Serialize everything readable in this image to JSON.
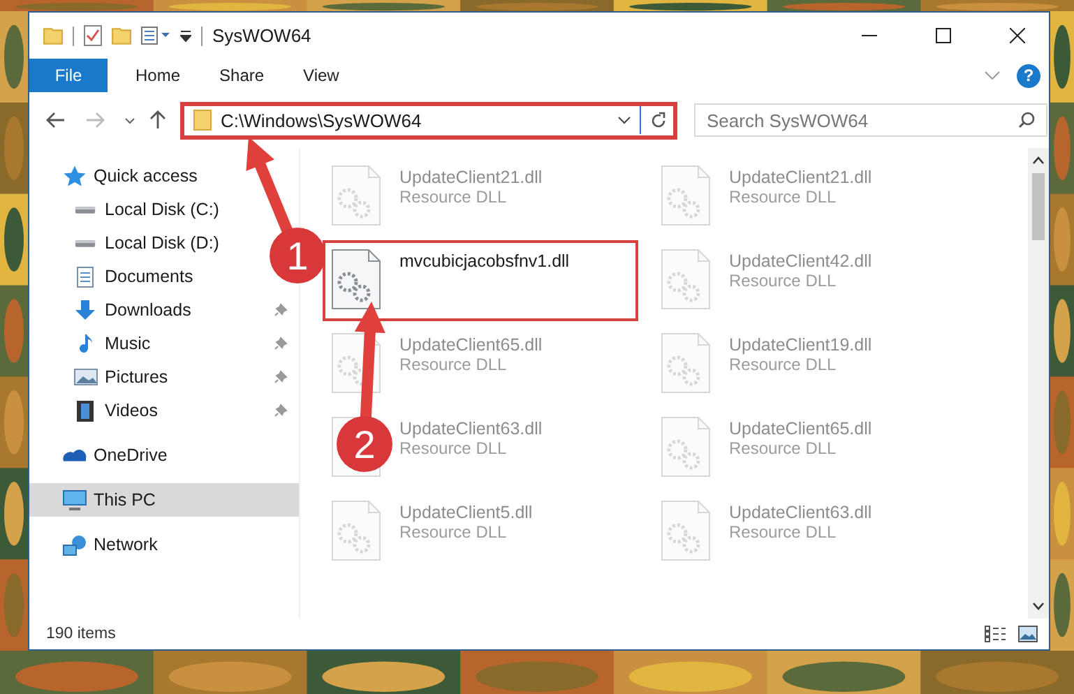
{
  "window": {
    "title": "SysWOW64"
  },
  "ribbon_tabs": [
    {
      "label": "File",
      "selected": true
    },
    {
      "label": "Home",
      "selected": false
    },
    {
      "label": "Share",
      "selected": false
    },
    {
      "label": "View",
      "selected": false
    }
  ],
  "help_button": {
    "label": "?"
  },
  "address_bar": {
    "path": "C:\\Windows\\SysWOW64",
    "highlighted": true
  },
  "search": {
    "placeholder": "Search SysWOW64"
  },
  "sidebar": {
    "items": [
      {
        "label": "Quick access",
        "kind": "star",
        "selected": false,
        "children": [
          {
            "label": "Local Disk (C:)",
            "kind": "drive",
            "pinned": false,
            "selected": false
          },
          {
            "label": "Local Disk (D:)",
            "kind": "drive",
            "pinned": false,
            "selected": false
          },
          {
            "label": "Documents",
            "kind": "document",
            "pinned": false,
            "selected": false
          },
          {
            "label": "Downloads",
            "kind": "download",
            "pinned": true,
            "selected": false
          },
          {
            "label": "Music",
            "kind": "music",
            "pinned": true,
            "selected": false
          },
          {
            "label": "Pictures",
            "kind": "pictures",
            "pinned": true,
            "selected": false
          },
          {
            "label": "Videos",
            "kind": "videos",
            "pinned": true,
            "selected": false
          }
        ]
      },
      {
        "label": "OneDrive",
        "kind": "cloud",
        "selected": false
      },
      {
        "label": "This PC",
        "kind": "computer",
        "selected": true
      },
      {
        "label": "Network",
        "kind": "network",
        "selected": false
      }
    ]
  },
  "files": [
    {
      "name": "UpdateClient21.dll",
      "type": "Resource DLL",
      "faded": true,
      "highlighted": false
    },
    {
      "name": "UpdateClient21.dll",
      "type": "Resource DLL",
      "faded": true,
      "highlighted": false
    },
    {
      "name": "mvcubicjacobsfnv1.dll",
      "faded": false,
      "highlighted": true
    },
    {
      "name": "UpdateClient42.dll",
      "type": "Resource DLL",
      "faded": true,
      "highlighted": false
    },
    {
      "name": "UpdateClient65.dll",
      "type": "Resource DLL",
      "faded": true,
      "highlighted": false
    },
    {
      "name": "UpdateClient19.dll",
      "type": "Resource DLL",
      "faded": true,
      "highlighted": false
    },
    {
      "name": "UpdateClient63.dll",
      "type": "Resource DLL",
      "faded": true,
      "highlighted": false
    },
    {
      "name": "UpdateClient65.dll",
      "type": "Resource DLL",
      "faded": true,
      "highlighted": false
    },
    {
      "name": "UpdateClient5.dll",
      "type": "Resource DLL",
      "faded": true,
      "highlighted": false
    },
    {
      "name": "UpdateClient63.dll",
      "type": "Resource DLL",
      "faded": true,
      "highlighted": false
    }
  ],
  "status_bar": {
    "item_count": "190 items"
  },
  "annotations": [
    {
      "label": "1"
    },
    {
      "label": "2"
    }
  ]
}
